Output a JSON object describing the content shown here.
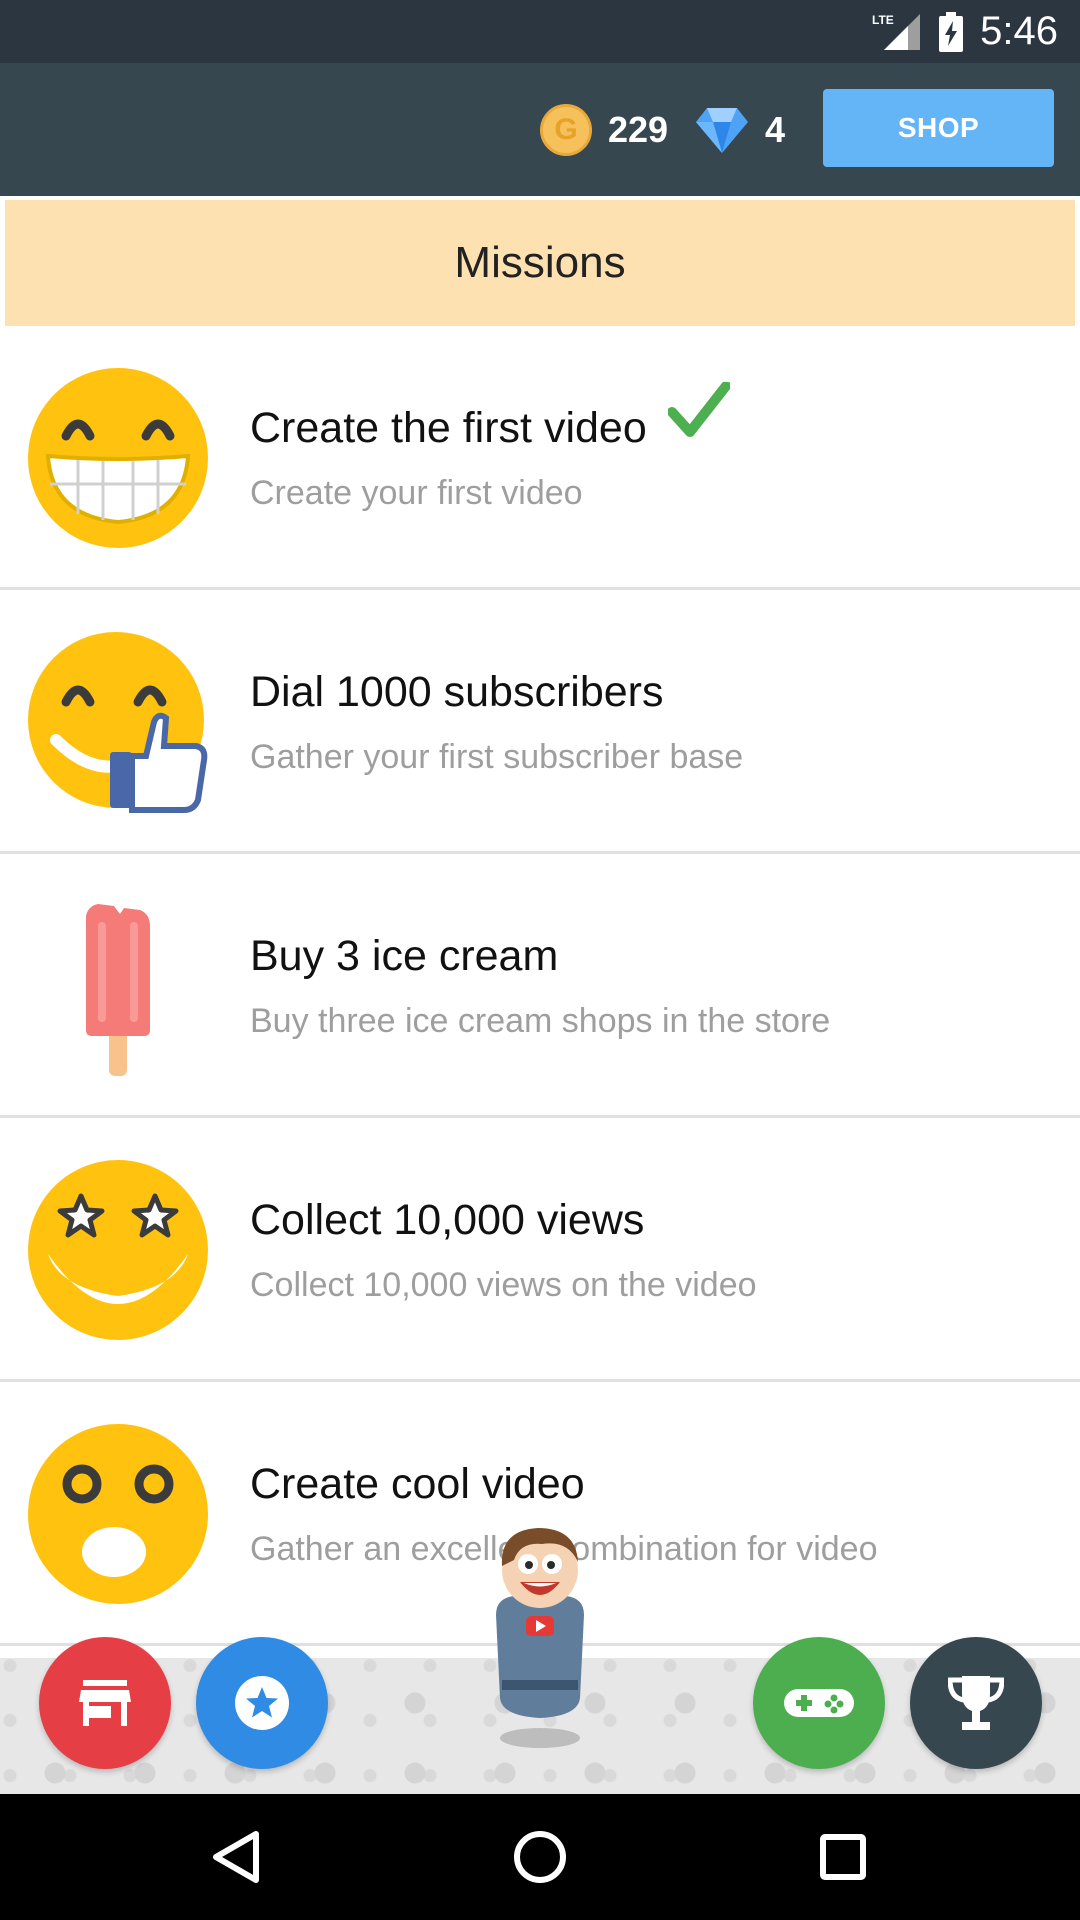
{
  "status_bar": {
    "network": "LTE",
    "time": "5:46"
  },
  "app_bar": {
    "coin_symbol": "G",
    "coins": "229",
    "gems": "4",
    "shop_label": "SHOP"
  },
  "missions": {
    "header": "Missions",
    "items": [
      {
        "title": "Create the first video",
        "description": "Create your first video",
        "icon": "grinning-face-icon",
        "completed": true
      },
      {
        "title": "Dial 1000 subscribers",
        "description": "Gather your first subscriber base",
        "icon": "smile-thumbs-up-icon",
        "completed": false
      },
      {
        "title": "Buy 3 ice cream",
        "description": "Buy three ice cream shops in the store",
        "icon": "popsicle-icon",
        "completed": false
      },
      {
        "title": "Collect 10,000 views",
        "description": "Collect 10,000 views on the video",
        "icon": "star-eyes-face-icon",
        "completed": false
      },
      {
        "title": "Create cool video",
        "description": "Gather an excellent combination for video",
        "icon": "surprised-face-icon",
        "completed": false
      }
    ]
  },
  "bottom_nav": {
    "buttons": [
      "store-icon",
      "star-icon",
      "gamepad-icon",
      "trophy-icon"
    ]
  },
  "colors": {
    "status_bar": "#2b3640",
    "app_bar": "#37474f",
    "shop_button": "#64b5f6",
    "missions_header": "#fde1b1",
    "store_fab": "#e53e45",
    "star_fab": "#2f8be3",
    "game_fab": "#4cae4f",
    "trophy_fab": "#37474f",
    "check": "#4caf50"
  }
}
